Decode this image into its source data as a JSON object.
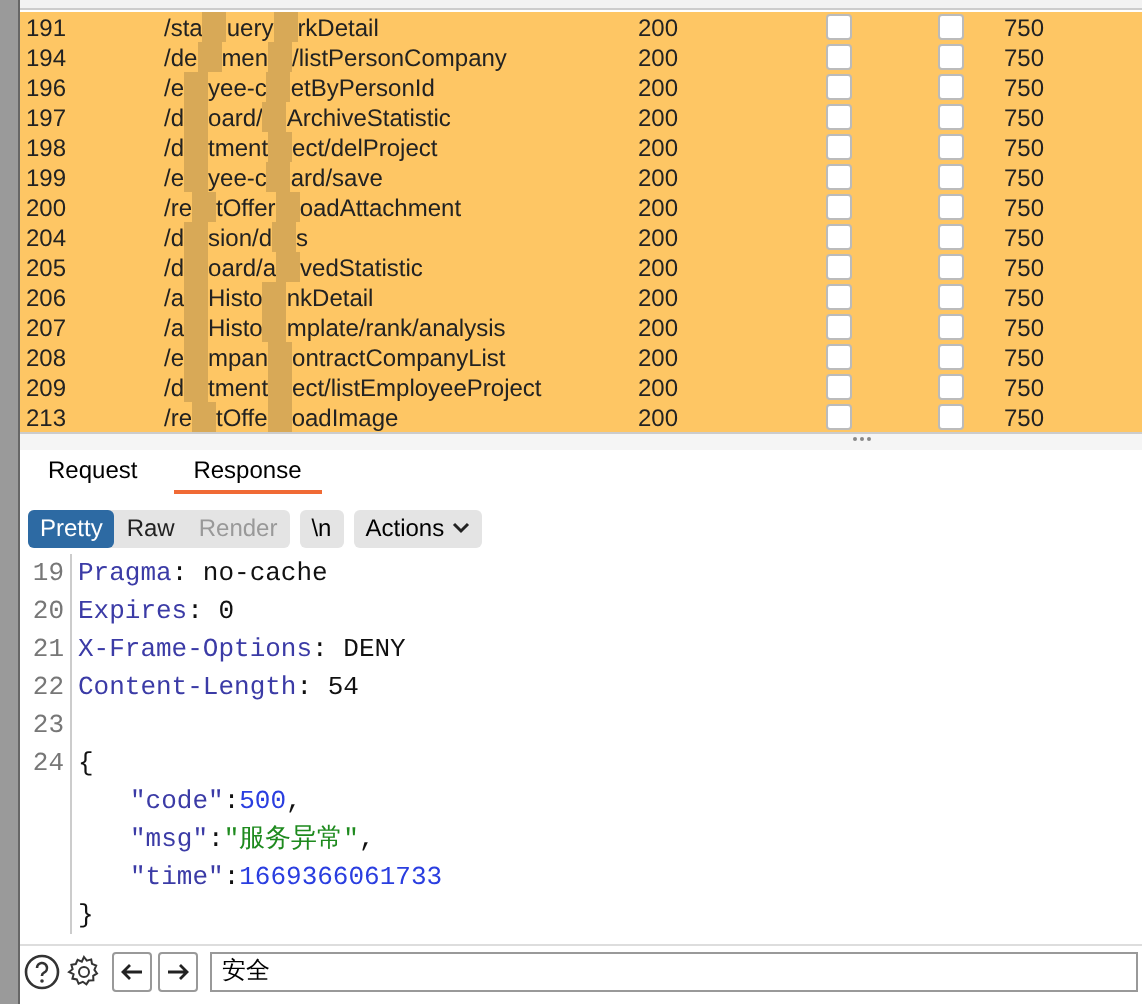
{
  "table": {
    "rows": [
      {
        "number": "191",
        "path_parts": [
          "/sta",
          "uery",
          "rkDetail"
        ],
        "status": "200",
        "flag_1": false,
        "flag_2": false,
        "length": "750"
      },
      {
        "number": "194",
        "path_parts": [
          "/de",
          "men",
          "/listPersonCompany"
        ],
        "status": "200",
        "flag_1": false,
        "flag_2": false,
        "length": "750"
      },
      {
        "number": "196",
        "path_parts": [
          "/e",
          "yee-c",
          "etByPersonId"
        ],
        "status": "200",
        "flag_1": false,
        "flag_2": false,
        "length": "750"
      },
      {
        "number": "197",
        "path_parts": [
          "/d",
          "oard/",
          "ArchiveStatistic"
        ],
        "status": "200",
        "flag_1": false,
        "flag_2": false,
        "length": "750"
      },
      {
        "number": "198",
        "path_parts": [
          "/d",
          "tment",
          "ect/delProject"
        ],
        "status": "200",
        "flag_1": false,
        "flag_2": false,
        "length": "750"
      },
      {
        "number": "199",
        "path_parts": [
          "/e",
          "yee-c",
          "ard/save"
        ],
        "status": "200",
        "flag_1": false,
        "flag_2": false,
        "length": "750"
      },
      {
        "number": "200",
        "path_parts": [
          "/re",
          "tOffer",
          "oadAttachment"
        ],
        "status": "200",
        "flag_1": false,
        "flag_2": false,
        "length": "750"
      },
      {
        "number": "204",
        "path_parts": [
          "/d",
          "sion/d",
          "s"
        ],
        "status": "200",
        "flag_1": false,
        "flag_2": false,
        "length": "750"
      },
      {
        "number": "205",
        "path_parts": [
          "/d",
          "oard/a",
          "vedStatistic"
        ],
        "status": "200",
        "flag_1": false,
        "flag_2": false,
        "length": "750"
      },
      {
        "number": "206",
        "path_parts": [
          "/a",
          "Histo",
          "nkDetail"
        ],
        "status": "200",
        "flag_1": false,
        "flag_2": false,
        "length": "750"
      },
      {
        "number": "207",
        "path_parts": [
          "/a",
          "Histo",
          "mplate/rank/analysis"
        ],
        "status": "200",
        "flag_1": false,
        "flag_2": false,
        "length": "750"
      },
      {
        "number": "208",
        "path_parts": [
          "/e",
          "mpan",
          "ontractCompanyList"
        ],
        "status": "200",
        "flag_1": false,
        "flag_2": false,
        "length": "750"
      },
      {
        "number": "209",
        "path_parts": [
          "/d",
          "tment",
          "ect/listEmployeeProject"
        ],
        "status": "200",
        "flag_1": false,
        "flag_2": false,
        "length": "750"
      },
      {
        "number": "213",
        "path_parts": [
          "/re",
          "tOffe",
          "oadImage"
        ],
        "status": "200",
        "flag_1": false,
        "flag_2": false,
        "length": "750"
      }
    ]
  },
  "tabs": [
    {
      "label": "Request",
      "selected": false
    },
    {
      "label": "Response",
      "selected": true
    }
  ],
  "view_buttons": [
    {
      "label": "Pretty",
      "selected": true,
      "disabled": false
    },
    {
      "label": "Raw",
      "selected": false,
      "disabled": false
    },
    {
      "label": "Render",
      "selected": false,
      "disabled": true
    }
  ],
  "newline_button": "\\n",
  "actions_button": "Actions",
  "code_lines": [
    {
      "kind": "header",
      "number": "19",
      "name": "Pragma",
      "sep": ": ",
      "value": "no-cache"
    },
    {
      "kind": "header",
      "number": "20",
      "name": "Expires",
      "sep": ": ",
      "value": "0"
    },
    {
      "kind": "header",
      "number": "21",
      "name": "X-Frame-Options",
      "sep": ": ",
      "value": "DENY"
    },
    {
      "kind": "header",
      "number": "22",
      "name": "Content-Length",
      "sep": ": ",
      "value": "54"
    },
    {
      "kind": "blank",
      "number": "23"
    },
    {
      "kind": "text",
      "number": "24",
      "text": "{"
    },
    {
      "kind": "json_number",
      "key": "\"code\"",
      "sep": ":",
      "value": "500",
      "trail": ","
    },
    {
      "kind": "json_string",
      "key": "\"msg\"",
      "sep": ":",
      "value": "\"服务异常\"",
      "trail": ","
    },
    {
      "kind": "json_number",
      "key": "\"time\"",
      "sep": ":",
      "value": "1669366061733"
    },
    {
      "kind": "text",
      "text": "}"
    }
  ],
  "search": {
    "value": "安全"
  }
}
